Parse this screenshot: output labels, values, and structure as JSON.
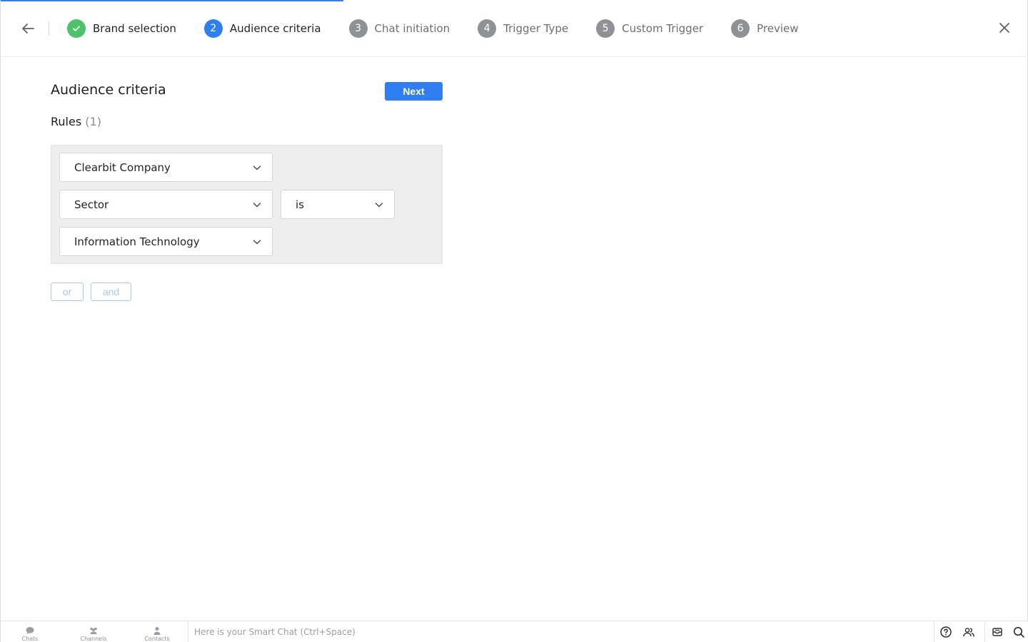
{
  "colors": {
    "accent": "#2f7ef2",
    "done": "#4cc36a",
    "pending": "#8e9196",
    "rules_bg": "#eeeeee",
    "logic_border": "#a9c9f5"
  },
  "header": {
    "back_icon": "arrow-left-icon",
    "close_icon": "close-icon",
    "steps": [
      {
        "number": "",
        "label": "Brand selection",
        "state": "done",
        "icon": "check-icon"
      },
      {
        "number": "2",
        "label": "Audience criteria",
        "state": "active"
      },
      {
        "number": "3",
        "label": "Chat initiation",
        "state": "pending"
      },
      {
        "number": "4",
        "label": "Trigger Type",
        "state": "pending"
      },
      {
        "number": "5",
        "label": "Custom Trigger",
        "state": "pending"
      },
      {
        "number": "6",
        "label": "Preview",
        "state": "pending"
      }
    ]
  },
  "main": {
    "title": "Audience criteria",
    "next_label": "Next",
    "rules_label": "Rules",
    "rules_count": "(1)",
    "rule": {
      "source": "Clearbit Company",
      "field": "Sector",
      "operator": "is",
      "value": "Information Technology"
    },
    "or_label": "or",
    "and_label": "and"
  },
  "bottombar": {
    "nav": [
      {
        "label": "Chats",
        "icon": "chat-bubble-icon"
      },
      {
        "label": "Channels",
        "icon": "group-icon"
      },
      {
        "label": "Contacts",
        "icon": "person-icon"
      }
    ],
    "smart_chat_placeholder": "Here is your Smart Chat (Ctrl+Space)",
    "tools": [
      "help-icon",
      "people-icon",
      "inbox-icon",
      "search-icon"
    ]
  }
}
